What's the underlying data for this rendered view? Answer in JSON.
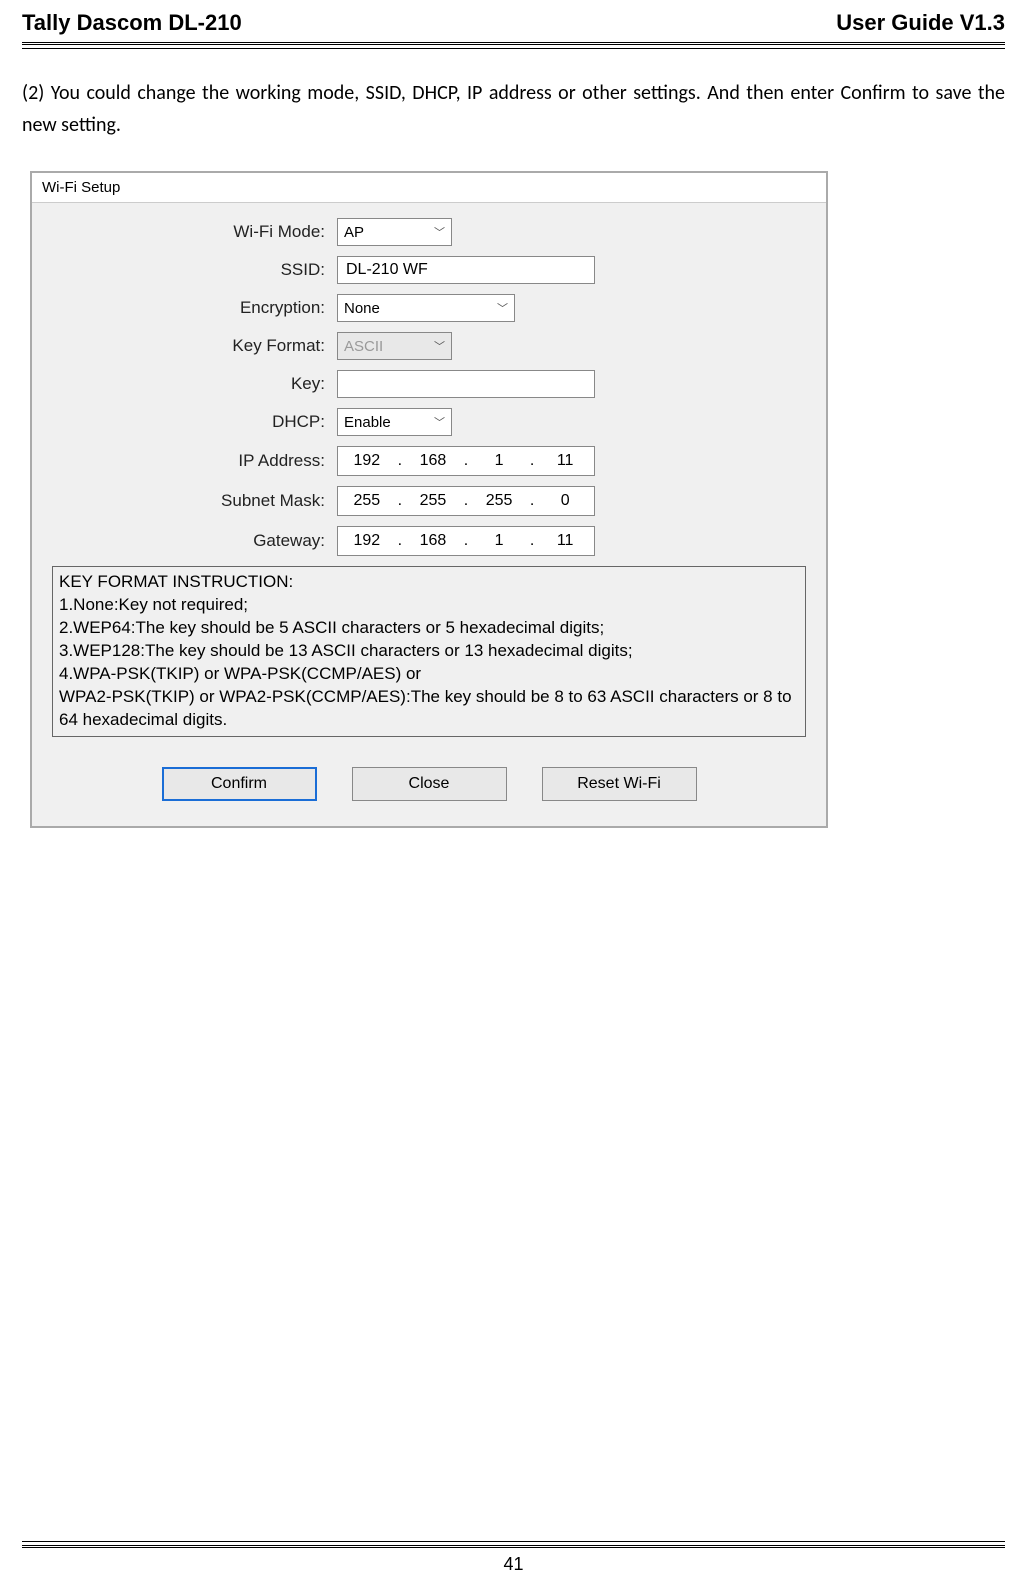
{
  "header": {
    "left": "Tally Dascom DL-210",
    "right": "User Guide V1.3"
  },
  "body_text": "(2) You could change the working mode, SSID, DHCP, IP address or other settings. And then enter Confirm to save the new setting.",
  "dialog": {
    "title": "Wi-Fi Setup",
    "labels": {
      "wifi_mode": "Wi-Fi Mode:",
      "ssid": "SSID:",
      "encryption": "Encryption:",
      "key_format": "Key Format:",
      "key": "Key:",
      "dhcp": "DHCP:",
      "ip_address": "IP Address:",
      "subnet_mask": "Subnet Mask:",
      "gateway": "Gateway:"
    },
    "values": {
      "wifi_mode": "AP",
      "ssid": "DL-210 WF",
      "encryption": "None",
      "key_format": "ASCII",
      "key": "",
      "dhcp": "Enable",
      "ip": [
        "192",
        "168",
        "1",
        "11"
      ],
      "subnet": [
        "255",
        "255",
        "255",
        "0"
      ],
      "gateway": [
        "192",
        "168",
        "1",
        "11"
      ]
    },
    "instruction": {
      "title": "KEY FORMAT INSTRUCTION:",
      "line1": "1.None:Key not required;",
      "line2": "2.WEP64:The key should be 5 ASCII characters or 5 hexadecimal digits;",
      "line3": "3.WEP128:The key should be 13 ASCII characters or 13 hexadecimal digits;",
      "line4": "4.WPA-PSK(TKIP) or WPA-PSK(CCMP/AES) or",
      "line5": "WPA2-PSK(TKIP) or WPA2-PSK(CCMP/AES):The key should be 8 to 63 ASCII characters or 8 to 64 hexadecimal digits."
    },
    "buttons": {
      "confirm": "Confirm",
      "close": "Close",
      "reset": "Reset Wi-Fi"
    }
  },
  "footer": {
    "page": "41"
  }
}
